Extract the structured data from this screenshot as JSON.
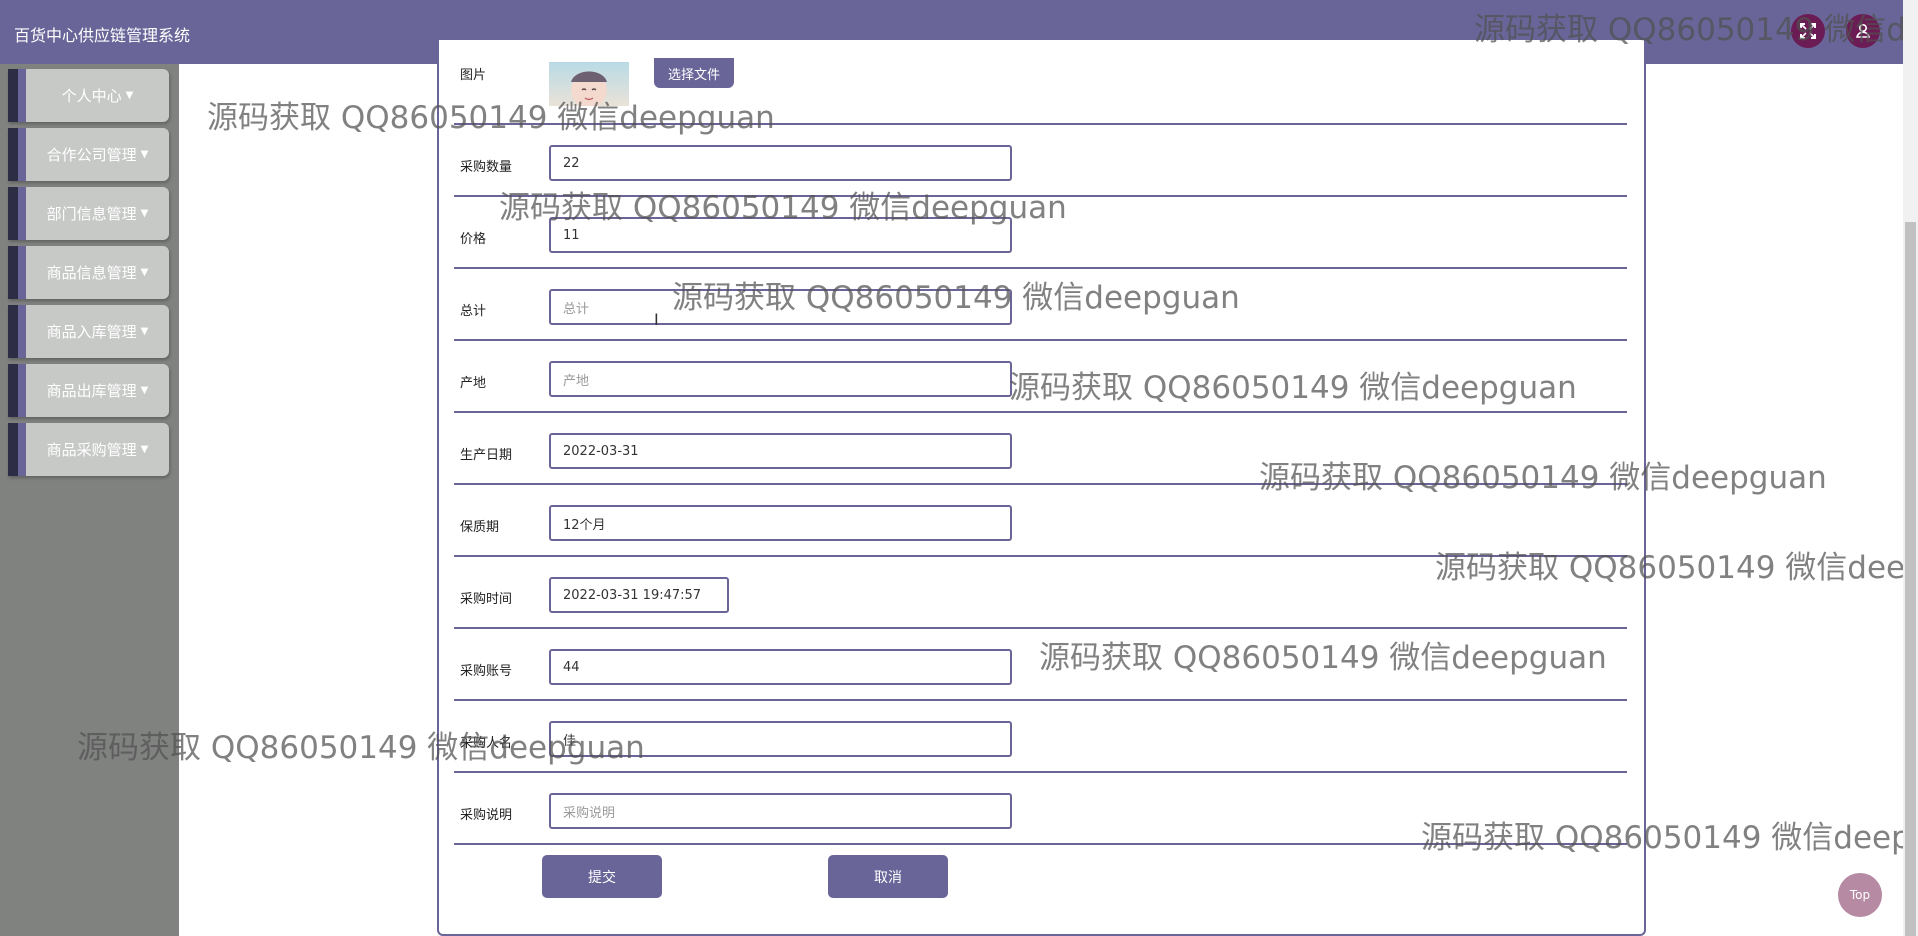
{
  "header": {
    "title": "百货中心供应链管理系统"
  },
  "sidebar": {
    "items": [
      {
        "label": "个人中心"
      },
      {
        "label": "合作公司管理"
      },
      {
        "label": "部门信息管理"
      },
      {
        "label": "商品信息管理"
      },
      {
        "label": "商品入库管理"
      },
      {
        "label": "商品出库管理"
      },
      {
        "label": "商品采购管理"
      }
    ]
  },
  "form": {
    "image_label": "图片",
    "file_button": "选择文件",
    "fields": [
      {
        "label": "采购数量",
        "value": "22",
        "placeholder": ""
      },
      {
        "label": "价格",
        "value": "11",
        "placeholder": ""
      },
      {
        "label": "总计",
        "value": "",
        "placeholder": "总计"
      },
      {
        "label": "产地",
        "value": "",
        "placeholder": "产地"
      },
      {
        "label": "生产日期",
        "value": "2022-03-31",
        "placeholder": ""
      },
      {
        "label": "保质期",
        "value": "12个月",
        "placeholder": ""
      },
      {
        "label": "采购时间",
        "value": "2022-03-31 19:47:57",
        "placeholder": ""
      },
      {
        "label": "采购账号",
        "value": "44",
        "placeholder": ""
      },
      {
        "label": "采购人名",
        "value": "佳",
        "placeholder": ""
      },
      {
        "label": "采购说明",
        "value": "",
        "placeholder": "采购说明"
      }
    ],
    "submit_label": "提交",
    "cancel_label": "取消"
  },
  "top_button": "Top",
  "watermark": {
    "text": "源码获取 QQ86050149 微信deepguan",
    "text_clipped_1": "源码获取 QQ86050149 微信dee",
    "text_clipped_2": "源码获取 QQ86050149 微信deepg",
    "text_clipped_3": "源码获取 QQ86050149 微信deepgu"
  },
  "colors": {
    "accent": "#6a6598",
    "sidebar_bg": "#808280",
    "menu_item_bg": "#c7c9c7",
    "header_icon_bg": "#6b1c54"
  },
  "icons": [
    "fullscreen-icon",
    "user-icon",
    "caret-down-icon"
  ]
}
